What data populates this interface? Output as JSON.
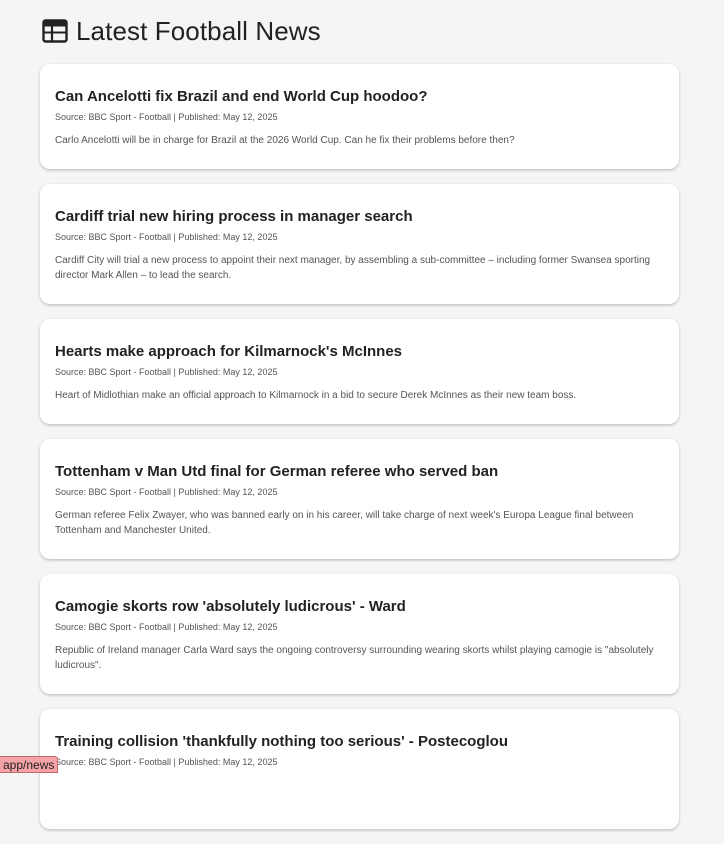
{
  "header": {
    "title": "Latest Football News",
    "icon": "newspaper-icon"
  },
  "articles": [
    {
      "title": "Can Ancelotti fix Brazil and end World Cup hoodoo?",
      "meta": "Source: BBC Sport - Football | Published: May 12, 2025",
      "summary": "Carlo Ancelotti will be in charge for Brazil at the 2026 World Cup. Can he fix their problems before then?"
    },
    {
      "title": "Cardiff trial new hiring process in manager search",
      "meta": "Source: BBC Sport - Football | Published: May 12, 2025",
      "summary": "Cardiff City will trial a new process to appoint their next manager, by assembling a sub-committee – including former Swansea sporting director Mark Allen – to lead the search."
    },
    {
      "title": "Hearts make approach for Kilmarnock's McInnes",
      "meta": "Source: BBC Sport - Football | Published: May 12, 2025",
      "summary": "Heart of Midlothian make an official approach to Kilmarnock in a bid to secure Derek McInnes as their new team boss."
    },
    {
      "title": "Tottenham v Man Utd final for German referee who served ban",
      "meta": "Source: BBC Sport - Football | Published: May 12, 2025",
      "summary": "German referee Felix Zwayer, who was banned early on in his career, will take charge of next week's Europa League final between Tottenham and Manchester United."
    },
    {
      "title": "Camogie skorts row 'absolutely ludicrous' - Ward",
      "meta": "Source: BBC Sport - Football | Published: May 12, 2025",
      "summary": "Republic of Ireland manager Carla Ward says the ongoing controversy surrounding wearing skorts whilst playing camogie is \"absolutely ludicrous\"."
    },
    {
      "title": "Training collision 'thankfully nothing too serious' - Postecoglou",
      "meta": "Source: BBC Sport - Football | Published: May 12, 2025",
      "summary": ""
    }
  ],
  "status_url": "app/news"
}
